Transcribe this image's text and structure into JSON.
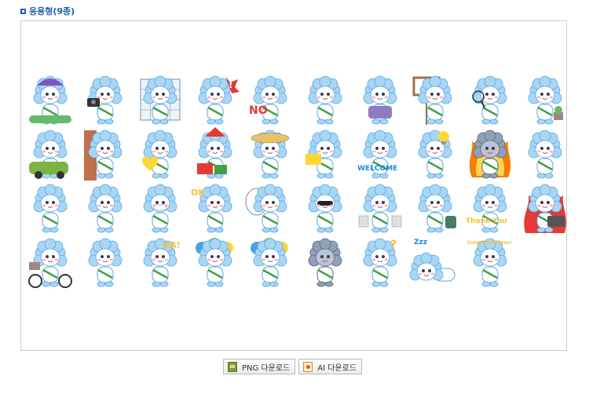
{
  "section": {
    "title": "응용형(9종)"
  },
  "stickers": [
    {
      "name": "sticker-purple-hat-picnic",
      "text": ""
    },
    {
      "name": "sticker-camera",
      "text": ""
    },
    {
      "name": "sticker-grid-window",
      "text": ""
    },
    {
      "name": "sticker-surprised",
      "text": "!"
    },
    {
      "name": "sticker-no",
      "text": "NO"
    },
    {
      "name": "sticker-cheering",
      "text": ""
    },
    {
      "name": "sticker-backpack",
      "text": ""
    },
    {
      "name": "sticker-sign-board",
      "text": ""
    },
    {
      "name": "sticker-magnifier",
      "text": ""
    },
    {
      "name": "sticker-plant",
      "text": ""
    },
    {
      "name": "sticker-green-car",
      "text": ""
    },
    {
      "name": "sticker-door-peek",
      "text": ""
    },
    {
      "name": "sticker-yellow-heart",
      "text": ""
    },
    {
      "name": "sticker-santa-gift",
      "text": ""
    },
    {
      "name": "sticker-straw-hat",
      "text": ""
    },
    {
      "name": "sticker-yellow-flag",
      "text": ""
    },
    {
      "name": "sticker-welcome",
      "text": "WELCOME"
    },
    {
      "name": "sticker-sleeping-idea",
      "text": ""
    },
    {
      "name": "sticker-fire-angry",
      "text": ""
    },
    {
      "name": "sticker-standing",
      "text": ""
    },
    {
      "name": "sticker-pointing",
      "text": ""
    },
    {
      "name": "sticker-waving",
      "text": ""
    },
    {
      "name": "sticker-face-mask",
      "text": ""
    },
    {
      "name": "sticker-ok",
      "text": "OK"
    },
    {
      "name": "sticker-speech-bubble",
      "text": ""
    },
    {
      "name": "sticker-sunglasses",
      "text": ""
    },
    {
      "name": "sticker-shopping",
      "text": ""
    },
    {
      "name": "sticker-suitcase",
      "text": ""
    },
    {
      "name": "sticker-thank-you",
      "text": "Thank You"
    },
    {
      "name": "sticker-laptop-fire",
      "text": ""
    },
    {
      "name": "sticker-bicycle",
      "text": ""
    },
    {
      "name": "sticker-blushing",
      "text": ""
    },
    {
      "name": "sticker-haha",
      "text": "HA!"
    },
    {
      "name": "sticker-balloons-1",
      "text": ""
    },
    {
      "name": "sticker-balloons-2",
      "text": ""
    },
    {
      "name": "sticker-dark-face",
      "text": ""
    },
    {
      "name": "sticker-question",
      "text": "?"
    },
    {
      "name": "sticker-sleeping",
      "text": "Zzz"
    },
    {
      "name": "sticker-congratulations",
      "text": "Congratulations!"
    }
  ],
  "buttons": {
    "png_label": "PNG 다운로드",
    "ai_label": "AI 다운로드"
  }
}
